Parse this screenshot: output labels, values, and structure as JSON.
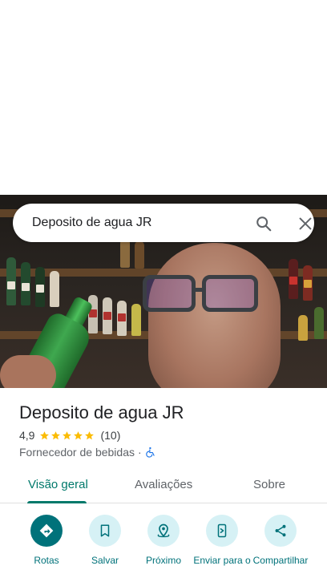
{
  "search": {
    "query": "Deposito de agua JR",
    "search_icon": "search-icon",
    "close_icon": "close-icon"
  },
  "place": {
    "title": "Deposito de agua JR",
    "rating": "4,9",
    "stars": 5,
    "review_count": "(10)",
    "category": "Fornecedor de bebidas",
    "separator": "·",
    "accessibility_icon": "wheelchair-icon"
  },
  "tabs": [
    {
      "label": "Visão geral",
      "active": true
    },
    {
      "label": "Avaliações",
      "active": false
    },
    {
      "label": "Sobre",
      "active": false
    }
  ],
  "actions": [
    {
      "label": "Rotas",
      "icon": "directions-icon"
    },
    {
      "label": "Salvar",
      "icon": "bookmark-icon"
    },
    {
      "label": "Próximo",
      "icon": "nearby-icon"
    },
    {
      "label": "Enviar para o",
      "icon": "send-to-phone-icon"
    },
    {
      "label": "Compartilhar",
      "icon": "share-icon"
    }
  ],
  "colors": {
    "accent": "#00727a",
    "tab_active": "#00796b",
    "star": "#fbbc04",
    "action_bg": "#d6f1f5",
    "accessibility": "#1a73e8"
  }
}
